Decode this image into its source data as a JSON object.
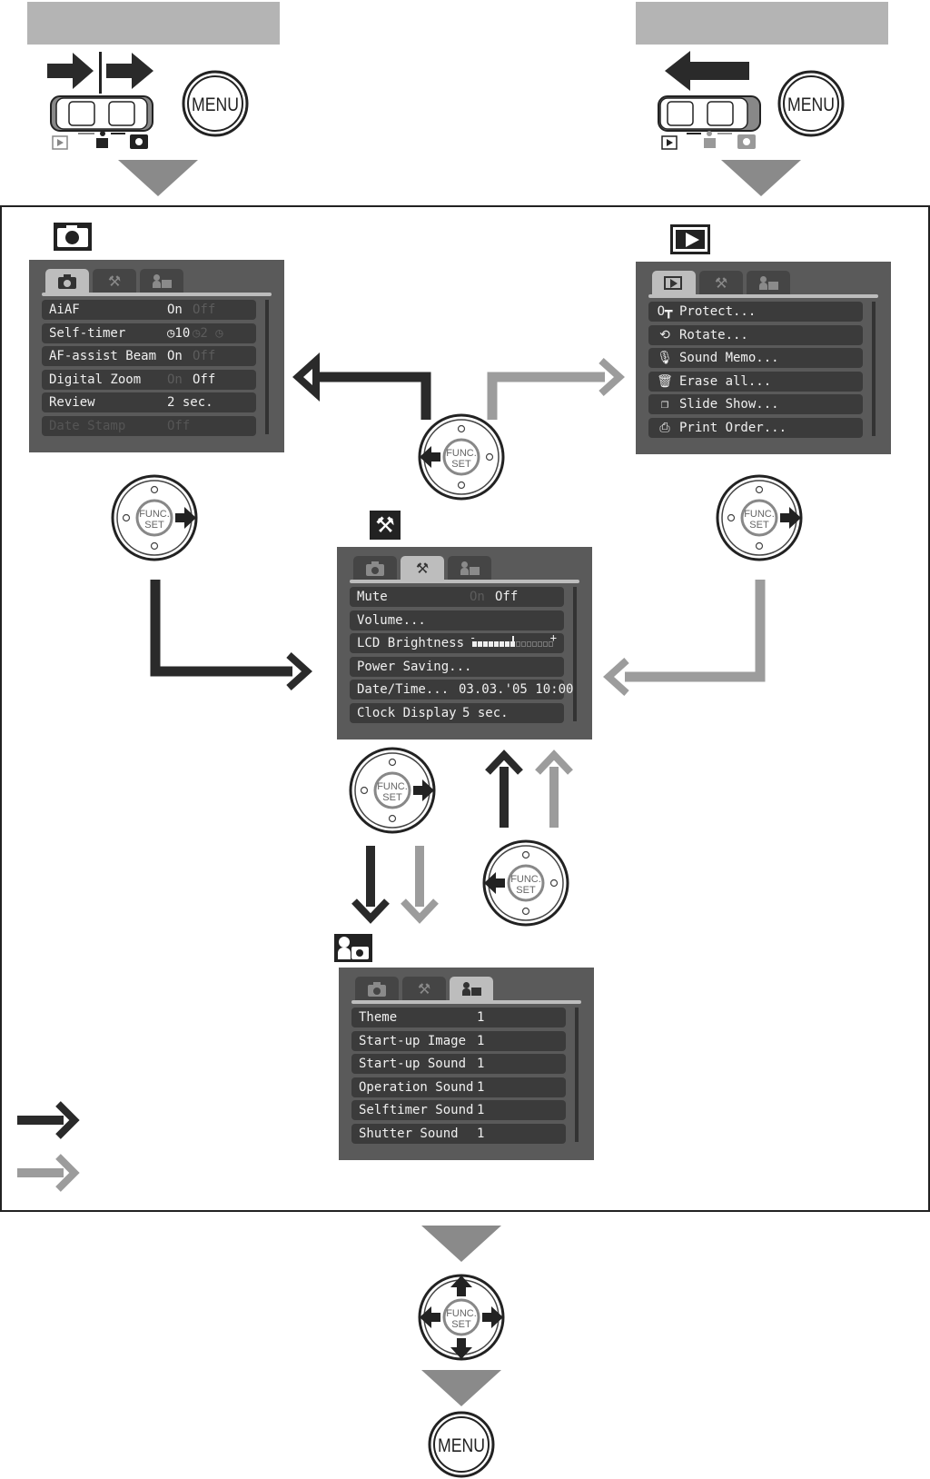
{
  "colors": {
    "dark_arrow": "#2a2a2a",
    "light_arrow": "#9c9c9c",
    "screen_bg": "#5a5a5a",
    "row_bg": "#3b3b3b",
    "tab_active": "#bdbdbd",
    "header_bar": "#b4b4b4",
    "triangle": "#8a8a8a"
  },
  "buttons": {
    "menu": "MENU",
    "func_line1": "FUNC.",
    "func_line2": "SET"
  },
  "shooting_menu": {
    "icon": "camera-icon",
    "tabs": [
      {
        "icon": "camera-icon",
        "active": true
      },
      {
        "icon": "wrench-hammer-icon",
        "active": false
      },
      {
        "icon": "my-camera-icon",
        "active": false
      }
    ],
    "rows": [
      {
        "label": "AiAF",
        "value": "On",
        "dim": "Off"
      },
      {
        "label": "Self-timer",
        "value": "◷10",
        "dim": "◷2 ◷"
      },
      {
        "label": "AF-assist Beam",
        "value": "On",
        "dim": "Off"
      },
      {
        "label": "Digital Zoom",
        "value": "Off",
        "dim": "On"
      },
      {
        "label": "Review",
        "value": "2 sec."
      },
      {
        "label": "Date Stamp",
        "value": "Off",
        "disabled": true
      }
    ]
  },
  "play_menu": {
    "icon": "play-icon",
    "tabs": [
      {
        "icon": "play-icon",
        "active": true
      },
      {
        "icon": "wrench-hammer-icon",
        "active": false
      },
      {
        "icon": "my-camera-icon",
        "active": false
      }
    ],
    "rows": [
      {
        "icon": "key-icon",
        "glyph": "O┳",
        "label": "Protect..."
      },
      {
        "icon": "rotate-icon",
        "glyph": "⟲",
        "label": "Rotate..."
      },
      {
        "icon": "microphone-icon",
        "glyph": "🎙",
        "label": "Sound Memo..."
      },
      {
        "icon": "erase-all-icon",
        "glyph": "🗑",
        "label": "Erase all..."
      },
      {
        "icon": "slide-show-icon",
        "glyph": "❐",
        "label": "Slide Show..."
      },
      {
        "icon": "print-order-icon",
        "glyph": "⎙",
        "label": "Print Order..."
      }
    ]
  },
  "setup_menu": {
    "icon": "wrench-hammer-icon",
    "tabs": [
      {
        "icon": "camera-icon",
        "active": false
      },
      {
        "icon": "wrench-hammer-icon",
        "active": true
      },
      {
        "icon": "my-camera-icon",
        "active": false
      }
    ],
    "rows": [
      {
        "label": "Mute",
        "value": "Off",
        "dim": "On"
      },
      {
        "label": "Volume..."
      },
      {
        "label": "LCD Brightness",
        "brightness_level": 8,
        "brightness_steps": 15,
        "minus": "-",
        "plus": "+"
      },
      {
        "label": "Power Saving..."
      },
      {
        "label": "Date/Time...",
        "value": "03.03.'05 10:00"
      },
      {
        "label": "Clock Display",
        "value": "5 sec."
      }
    ]
  },
  "my_camera_menu": {
    "icon": "my-camera-icon",
    "tabs": [
      {
        "icon": "camera-icon",
        "active": false
      },
      {
        "icon": "wrench-hammer-icon",
        "active": false
      },
      {
        "icon": "my-camera-icon",
        "active": true
      }
    ],
    "rows": [
      {
        "label": "Theme",
        "value": "1"
      },
      {
        "label": "Start-up Image",
        "value": "1"
      },
      {
        "label": "Start-up Sound",
        "value": "1"
      },
      {
        "label": "Operation Sound",
        "value": "1"
      },
      {
        "label": "Selftimer Sound",
        "value": "1"
      },
      {
        "label": "Shutter Sound",
        "value": "1"
      }
    ]
  }
}
